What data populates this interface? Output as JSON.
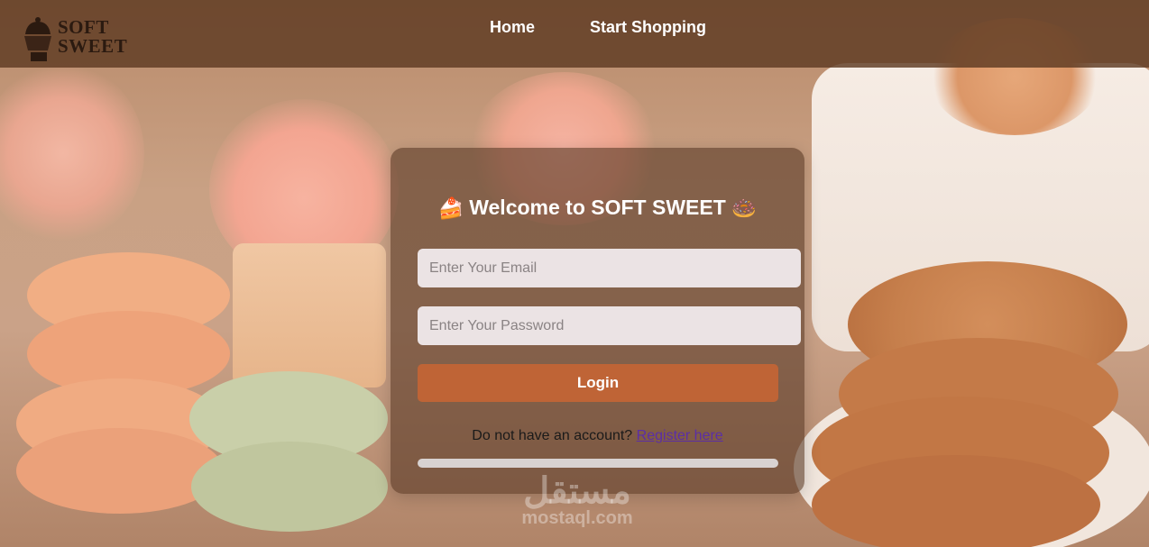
{
  "brand": {
    "line1": "SOFT",
    "line2": "SWEET"
  },
  "nav": {
    "items": [
      {
        "label": "Home"
      },
      {
        "label": "Start Shopping"
      }
    ]
  },
  "login": {
    "title": "Welcome to SOFT SWEET",
    "title_icon_left": "🍰",
    "title_icon_right": "🍩",
    "email_placeholder": "Enter Your Email",
    "password_placeholder": "Enter Your Password",
    "button_label": "Login",
    "register_prompt": "Do not have an account?",
    "register_link": "Register here",
    "progress": 1.0
  },
  "watermark": {
    "arabic": "مستقل",
    "latin": "mostaql.com"
  },
  "colors": {
    "nav_bg": "#5e3a22",
    "button": "#bf6436",
    "link": "#5b2ea6"
  }
}
